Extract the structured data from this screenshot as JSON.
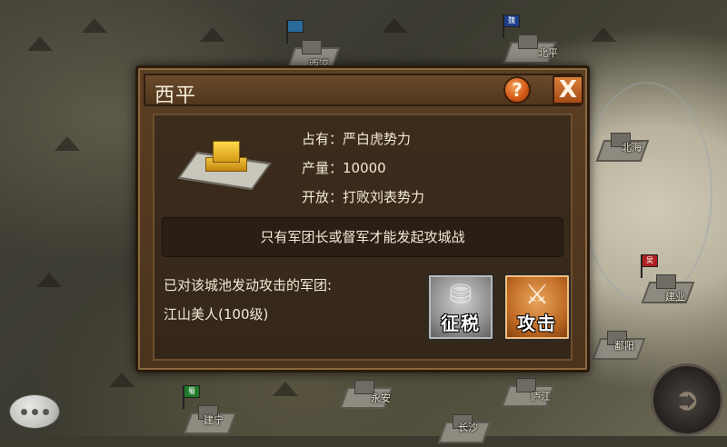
{
  "map": {
    "cities": [
      {
        "name": "北平",
        "flag_text": "魏",
        "flag_color": "#1f3e8a"
      },
      {
        "name": "西凉",
        "flag_text": "",
        "flag_color": "#2a6a9a"
      },
      {
        "name": "北海",
        "flag_text": "",
        "flag_color": ""
      },
      {
        "name": "建业",
        "flag_text": "吴",
        "flag_color": "#b02020"
      },
      {
        "name": "鄱阳",
        "flag_text": "",
        "flag_color": ""
      },
      {
        "name": "庐江",
        "flag_text": "",
        "flag_color": ""
      },
      {
        "name": "永安",
        "flag_text": "",
        "flag_color": ""
      },
      {
        "name": "建宁",
        "flag_text": "蜀",
        "flag_color": "#1f7a2a"
      },
      {
        "name": "长沙",
        "flag_text": "",
        "flag_color": ""
      }
    ]
  },
  "dialog": {
    "title": "西平",
    "help_label": "?",
    "close_label": "X",
    "occupant_label": "占有：严白虎势力",
    "output_label": "产量：10000",
    "open_label": "开放：打败刘表势力",
    "notice": "只有军团长或督军才能发起攻城战",
    "attackers_label": "已对该城池发动攻击的军团:",
    "attackers": [
      "江山美人(100级)"
    ],
    "tax_button": "征税",
    "attack_button": "攻击"
  },
  "icons": {
    "help": "question-icon",
    "close": "close-icon",
    "tax": "coins-icon",
    "attack": "crossed-swords-icon",
    "chat": "chat-bubble-icon",
    "nav": "arrow-right-icon"
  }
}
